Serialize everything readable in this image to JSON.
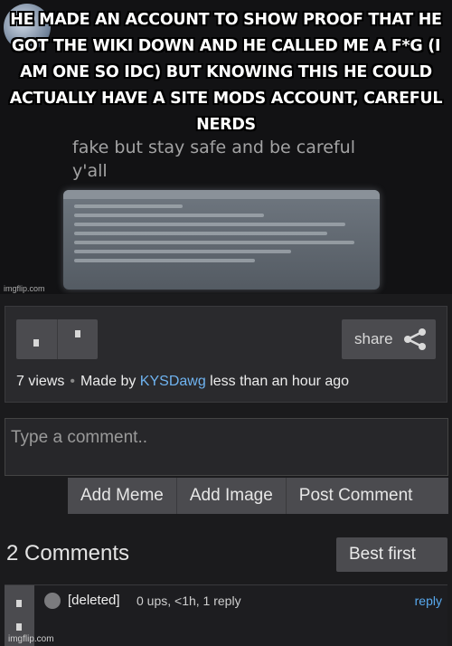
{
  "meme": {
    "caption": "He made an account to show proof that he got the wiki down and he called me a f*g (I am one so idc) but knowing this he could actually have a site mods account, careful nerds",
    "bg_line_1": "fake but stay safe and be careful",
    "bg_line_2": "y'all",
    "watermark": "imgflip.com"
  },
  "actions": {
    "share_label": "share",
    "views": "7 views",
    "made_by_prefix": "Made by",
    "author": "KYSDawg",
    "time": "less than an hour ago"
  },
  "compose": {
    "placeholder": "Type a comment..",
    "buttons": [
      "Add Meme",
      "Add Image",
      "Post Comment"
    ]
  },
  "comments": {
    "title": "2 Comments",
    "sort": "Best first",
    "items": [
      {
        "user": "[deleted]",
        "meta": "0 ups, <1h, 1 reply",
        "reply": "reply"
      }
    ]
  },
  "footer_watermark": "imgflip.com"
}
